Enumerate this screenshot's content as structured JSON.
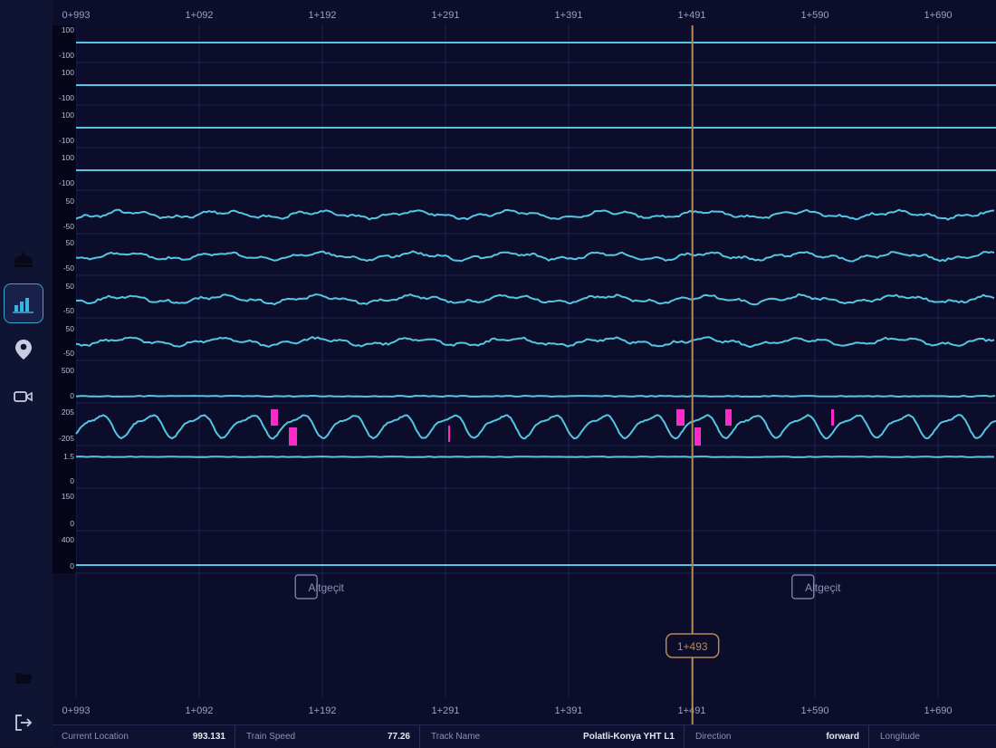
{
  "axis": {
    "top_ticks": [
      "0+993",
      "1+092",
      "1+192",
      "1+291",
      "1+391",
      "1+491",
      "1+590",
      "1+690"
    ],
    "bottom_ticks": [
      "0+993",
      "1+092",
      "1+192",
      "1+291",
      "1+391",
      "1+491",
      "1+590",
      "1+690"
    ]
  },
  "cursor": {
    "label": "1+493",
    "position_fraction": 0.67
  },
  "markers": [
    {
      "label": "Altgeçit",
      "position_fraction": 0.26
    },
    {
      "label": "Altgeçit",
      "position_fraction": 0.8
    }
  ],
  "channels": [
    {
      "top": "100",
      "bottom": "-100",
      "kind": "flat"
    },
    {
      "top": "100",
      "bottom": "-100",
      "kind": "flat"
    },
    {
      "top": "100",
      "bottom": "-100",
      "kind": "flat"
    },
    {
      "top": "100",
      "bottom": "-100",
      "kind": "flat"
    },
    {
      "top": "50",
      "bottom": "-50",
      "kind": "wave"
    },
    {
      "top": "50",
      "bottom": "-50",
      "kind": "wave"
    },
    {
      "top": "50",
      "bottom": "-50",
      "kind": "wave"
    },
    {
      "top": "50",
      "bottom": "-50",
      "kind": "wave"
    },
    {
      "top": "500",
      "bottom": "0",
      "kind": "low"
    },
    {
      "top": "205",
      "bottom": "-205",
      "kind": "periodic"
    },
    {
      "top": "1.5",
      "bottom": "0",
      "kind": "high"
    },
    {
      "top": "150",
      "bottom": "0",
      "kind": "empty"
    },
    {
      "top": "400",
      "bottom": "0",
      "kind": "lowflat"
    }
  ],
  "status_bar": {
    "current_location_label": "Current Location",
    "current_location_value": "993.131",
    "train_speed_label": "Train Speed",
    "train_speed_value": "77.26",
    "track_name_label": "Track Name",
    "track_name_value": "Polatli-Konya YHT L1",
    "direction_label": "Direction",
    "direction_value": "forward",
    "longitude_label": "Longitude"
  },
  "sidebar": {
    "items": [
      {
        "icon": "train-icon",
        "active": false
      },
      {
        "icon": "bar-chart-icon",
        "active": true
      },
      {
        "icon": "location-pin-icon",
        "active": false
      },
      {
        "icon": "video-camera-icon",
        "active": false
      },
      {
        "icon": "folder-icon",
        "active": false
      },
      {
        "icon": "logout-icon",
        "active": false
      }
    ]
  },
  "colors": {
    "background": "#0b0d2b",
    "signal": "#54c6e2",
    "cursor": "#b7875a",
    "defect": "#ff29c9",
    "grid": "#1f2452"
  }
}
